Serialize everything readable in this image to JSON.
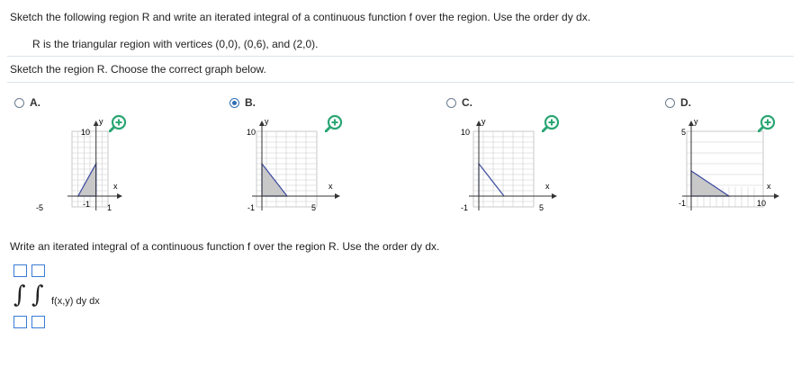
{
  "question": {
    "instruction": "Sketch the following region R and write an iterated integral of a continuous function f over the region. Use the order dy dx.",
    "region_desc": "R is the triangular region with vertices (0,0), (0,6), and (2,0)."
  },
  "part1": {
    "prompt": "Sketch the region R. Choose the correct graph below."
  },
  "options": [
    {
      "letter": "A.",
      "selected": false,
      "labels": {
        "ymax": "10",
        "xmin": "-5",
        "ymin": "-1",
        "xmax": "1",
        "xaxis": "x",
        "yaxis": "y"
      }
    },
    {
      "letter": "B.",
      "selected": true,
      "labels": {
        "ymax": "10",
        "xmin": "-1",
        "xmax": "5",
        "xaxis": "x",
        "yaxis": "y"
      }
    },
    {
      "letter": "C.",
      "selected": false,
      "labels": {
        "ymax": "10",
        "xmin": "-1",
        "xmax": "5",
        "xaxis": "x",
        "yaxis": "y"
      }
    },
    {
      "letter": "D.",
      "selected": false,
      "labels": {
        "ymax": "5",
        "xmin": "-1",
        "xmax": "10",
        "xaxis": "x",
        "yaxis": "y"
      }
    }
  ],
  "part2": {
    "prompt": "Write an iterated integral of a continuous function f over the region R. Use the order dy dx.",
    "integrand": "f(x,y) dy dx"
  },
  "colors": {
    "accent": "#2f6fb5",
    "zoom_green": "#2aa673",
    "region_fill": "#c8c8c8",
    "region_edge": "#3848a0"
  },
  "icons": {
    "zoom": "zoom-in-icon",
    "radio": "radio-button"
  }
}
